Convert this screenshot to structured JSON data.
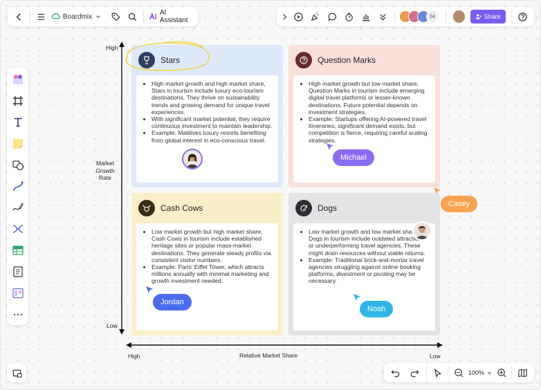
{
  "topbar": {
    "brand": "Boardmix",
    "ai_assistant": "AI Assistant",
    "collaborators_count": "24",
    "share": "Share"
  },
  "quadrants": {
    "stars": {
      "title": "Stars",
      "bullets": [
        "High market growth and high market share, Stars in tourism include luxury eco-tourism destinations. They thrive on sustainability trends and growing demand for unique travel experiences.",
        "With significant market potential, they require continuous investment to maintain leadership.",
        "Example: Maldives luxury resorts benefiting from global interest in eco-conscious travel."
      ]
    },
    "question_marks": {
      "title": "Question Marks",
      "bullets": [
        "High market growth but low market share, Question Marks in tourism include emerging digital travel platforms or lesser-known destinations. Future potential depends on investment strategies.",
        "Example: Startups offering AI-powered travel itineraries; significant demand exists, but competition is fierce, requiring careful scaling strategies."
      ]
    },
    "cash_cows": {
      "title": "Cash Cows",
      "bullets": [
        "Low market growth but high market share, Cash Cows in tourism include established heritage sites or popular mass-market destinations. They generate steady profits via consistent visitor numbers.",
        "Example: Paris' Eiffel Tower, which attracts millions annually with minimal marketing and growth investment needed."
      ]
    },
    "dogs": {
      "title": "Dogs",
      "bullets": [
        "Low market growth and low market share, Dogs in tourism include outdated attractions or underperforming travel agencies. These might drain resources without viable returns.",
        "Example: Traditional brick-and-mortar travel agencies struggling against online booking platforms; divestment or pivoting may be necessary."
      ]
    }
  },
  "axes": {
    "y_high": "High",
    "y_low": "Low",
    "y_title_lines": [
      "Market",
      "Growth",
      "Rate"
    ],
    "x_high": "High",
    "x_low": "Low",
    "x_title": "Relative Market Share"
  },
  "collaborators": {
    "michael": "Michael",
    "casey": "Casey",
    "jordan": "Jordan",
    "noah": "Noah"
  },
  "bottombar": {
    "zoom": "100%"
  },
  "colors": {
    "accent": "#7b5cf0",
    "stars_bg": "#dde9f9",
    "question_bg": "#f9e0da",
    "cashcows_bg": "#fbefc9",
    "dogs_bg": "#e4e4e6",
    "michael": "#8a6cf2",
    "casey": "#f6a34e",
    "jordan": "#4a6cf2",
    "noah": "#2fb6e8"
  }
}
